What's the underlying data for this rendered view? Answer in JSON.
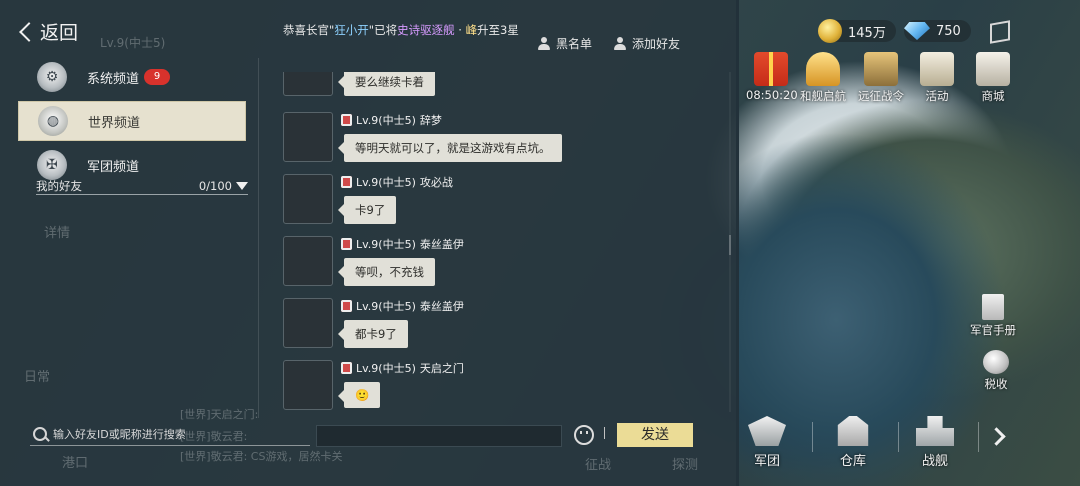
{
  "header": {
    "back_label": "返回"
  },
  "broadcast": {
    "prefix": "恭喜长官\"",
    "player": "狂小开",
    "middle": "\"已将",
    "ship": "史诗驱逐舰",
    "suffix_a": " · ",
    "rank": "峰",
    "suffix_b": "升至3星"
  },
  "top_actions": {
    "blacklist": "黑名单",
    "add_friend": "添加好友"
  },
  "channels": [
    {
      "label": "系统频道",
      "badge": "9"
    },
    {
      "label": "世界频道",
      "badge": ""
    },
    {
      "label": "军团频道",
      "badge": ""
    }
  ],
  "friends": {
    "label": "我的好友",
    "count": "0/100"
  },
  "messages": [
    {
      "sender": "",
      "level": "",
      "text": "要么继续卡着"
    },
    {
      "sender": "辞梦",
      "level": "Lv.9(中士5)",
      "text": "等明天就可以了，就是这游戏有点坑。"
    },
    {
      "sender": "攻必战",
      "level": "Lv.9(中士5)",
      "text": "卡9了"
    },
    {
      "sender": "泰丝盖伊",
      "level": "Lv.9(中士5)",
      "text": "等呗，不充钱"
    },
    {
      "sender": "泰丝盖伊",
      "level": "Lv.9(中士5)",
      "text": "都卡9了"
    },
    {
      "sender": "天启之门",
      "level": "Lv.9(中士5)",
      "text": "🙂"
    }
  ],
  "input": {
    "search_placeholder": "输入好友ID或昵称进行搜索",
    "send_label": "发送"
  },
  "background_text": {
    "level": "Lv.9(中士5)",
    "daily": "日常",
    "port": "港口",
    "expedition": "征战",
    "detect": "探测",
    "details": "详情",
    "feed_1": "[世界]天启之门:",
    "feed_2": "[世界]敬云君:",
    "feed_3": "[世界]敬云君: CS游戏，居然卡关"
  },
  "resources": {
    "coins": "145万",
    "gems": "750"
  },
  "hud": {
    "timer": "08:50:20",
    "gift_label": "和舰启航",
    "expedition_label": "远征战令",
    "event_label": "活动",
    "mall_label": "商城",
    "manual_label": "军官手册",
    "tax_label": "税收"
  },
  "nav": {
    "corps": "军团",
    "depot": "仓库",
    "warship": "战舰"
  }
}
